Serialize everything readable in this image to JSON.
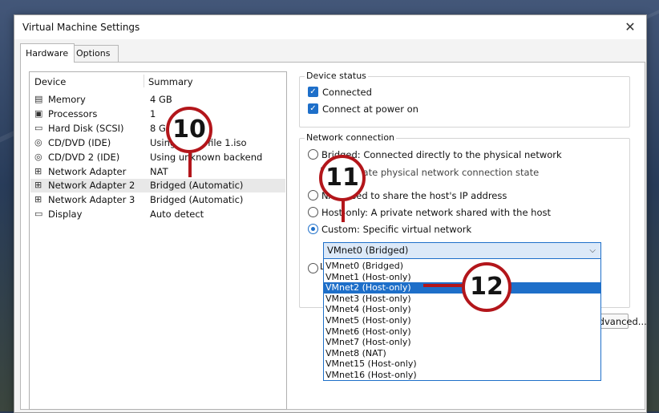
{
  "window": {
    "title": "Virtual Machine Settings",
    "close_glyph": "✕"
  },
  "tabs": [
    {
      "label": "Hardware"
    },
    {
      "label": "Options"
    }
  ],
  "device_list": {
    "col_device": "Device",
    "col_summary": "Summary",
    "rows": [
      {
        "name": "Memory",
        "summary": "4 GB",
        "icon": "memory-icon"
      },
      {
        "name": "Processors",
        "summary": "1",
        "icon": "processor-icon"
      },
      {
        "name": "Hard Disk (SCSI)",
        "summary": "8 GB",
        "icon": "hard-disk-icon"
      },
      {
        "name": "CD/DVD (IDE)",
        "summary": "Using file ...-file 1.iso",
        "icon": "cd-dvd-icon"
      },
      {
        "name": "CD/DVD 2 (IDE)",
        "summary": "Using unknown backend",
        "icon": "cd-dvd-icon"
      },
      {
        "name": "Network Adapter",
        "summary": "NAT",
        "icon": "network-adapter-icon"
      },
      {
        "name": "Network Adapter 2",
        "summary": "Bridged (Automatic)",
        "icon": "network-adapter-icon"
      },
      {
        "name": "Network Adapter 3",
        "summary": "Bridged (Automatic)",
        "icon": "network-adapter-icon"
      },
      {
        "name": "Display",
        "summary": "Auto detect",
        "icon": "display-icon"
      }
    ]
  },
  "device_status": {
    "title": "Device status",
    "connected": "Connected",
    "connect_at_power_on": "Connect at power on"
  },
  "network_connection": {
    "title": "Network connection",
    "bridged": "Bridged: Connected directly to the physical network",
    "replicate": "Replicate physical network connection state",
    "nat": "NAT: Used to share the host's IP address",
    "host_only": "Host-only: A private network shared with the host",
    "custom": "Custom: Specific virtual network",
    "lan_segment": "L",
    "selected_network": "VMnet0 (Bridged)",
    "options": [
      "VMnet0 (Bridged)",
      "VMnet1 (Host-only)",
      "VMnet2 (Host-only)",
      "VMnet3 (Host-only)",
      "VMnet4 (Host-only)",
      "VMnet5 (Host-only)",
      "VMnet6 (Host-only)",
      "VMnet7 (Host-only)",
      "VMnet8 (NAT)",
      "VMnet15 (Host-only)",
      "VMnet16 (Host-only)"
    ],
    "highlighted_option": "VMnet2 (Host-only)"
  },
  "advanced_button": "Advanced...",
  "callouts": [
    "10",
    "11",
    "12"
  ],
  "colors": {
    "accent": "#1e6fc9",
    "callout": "#b3161b"
  }
}
